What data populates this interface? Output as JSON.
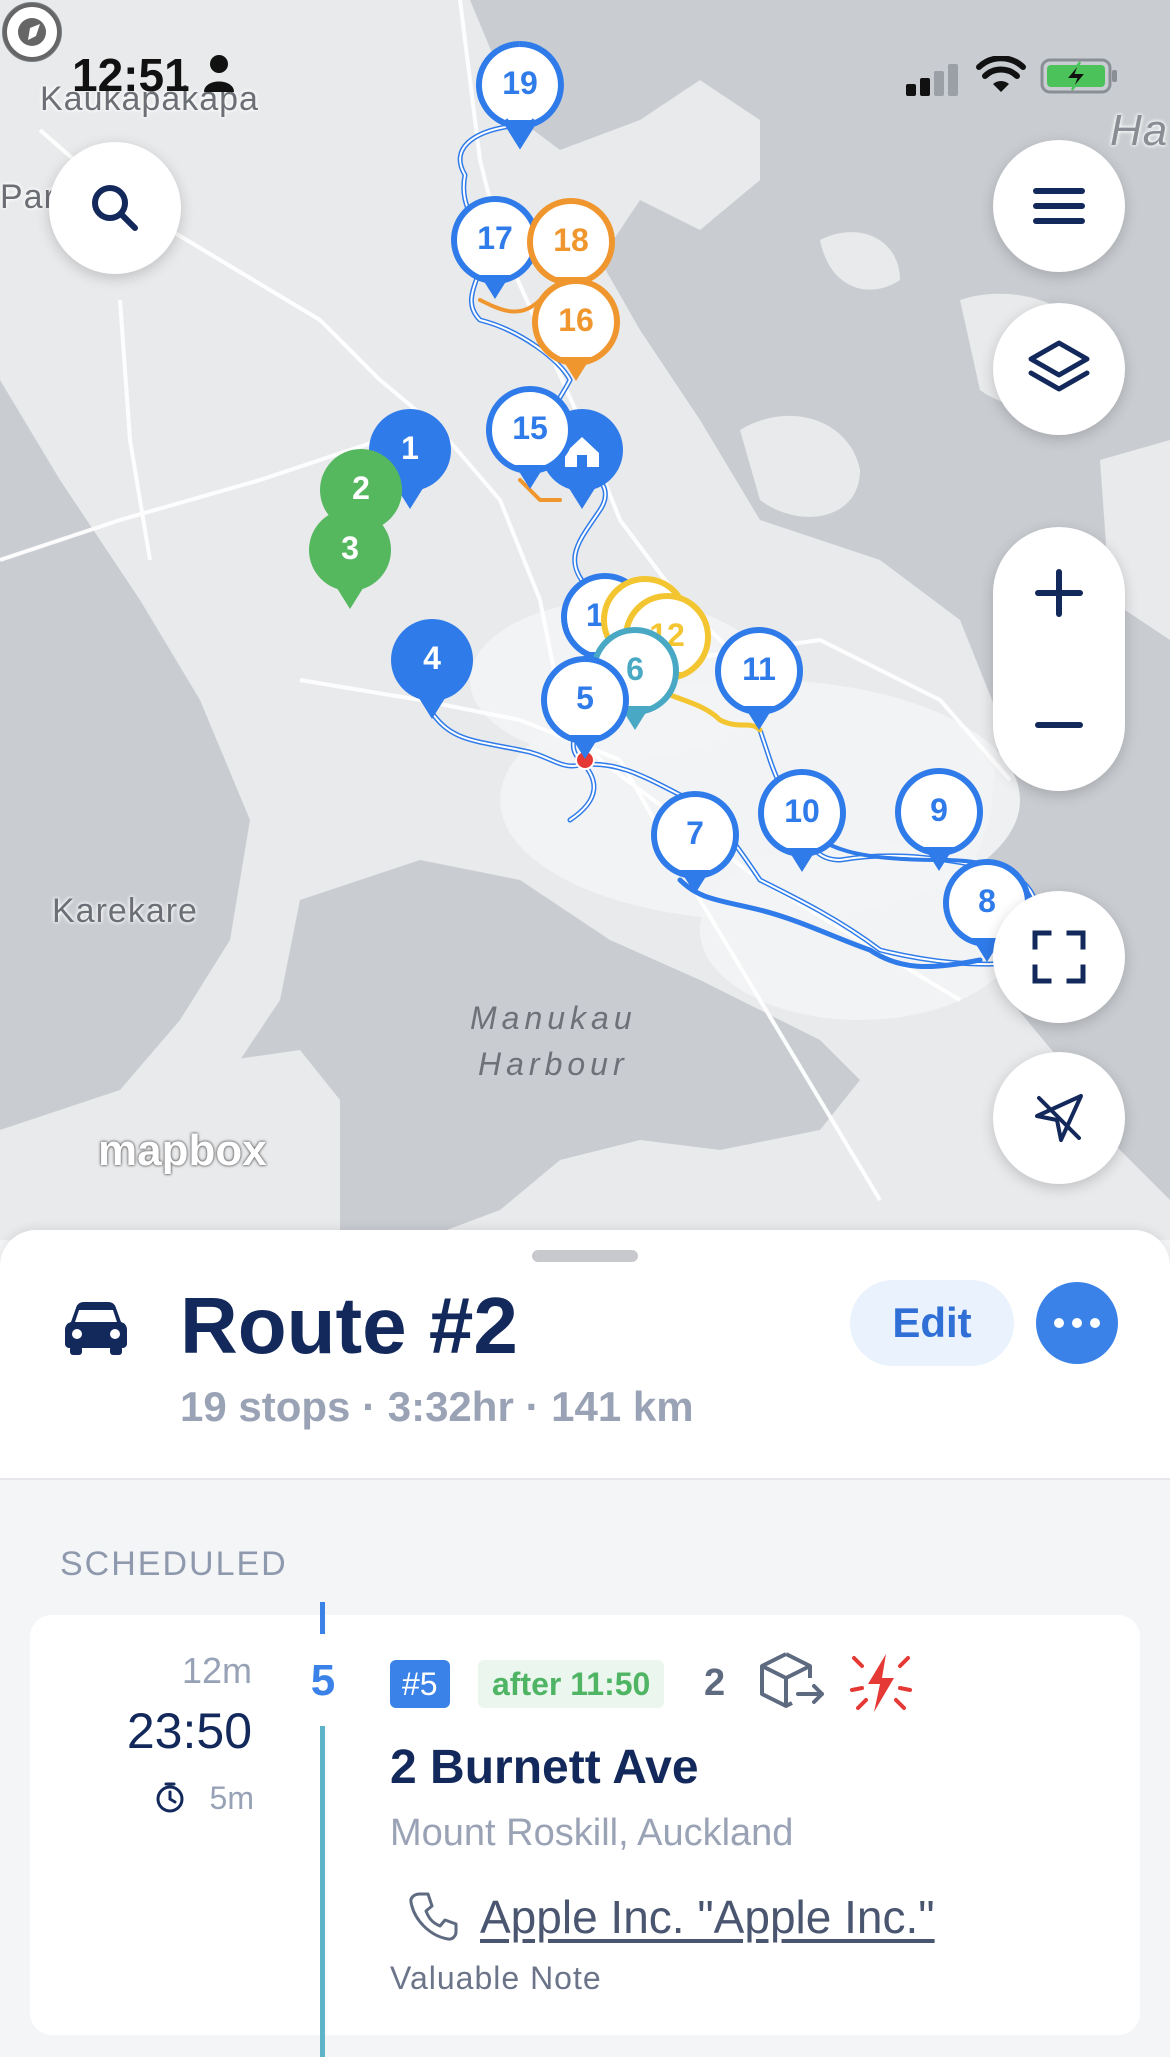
{
  "status_bar": {
    "time": "12:51"
  },
  "map": {
    "labels": {
      "kaukapakapa": "Kaukapakapa",
      "par": "Par",
      "ha": "Ha",
      "karekare": "Karekare",
      "harbour_line1": "Manukau",
      "harbour_line2": "Harbour"
    },
    "attribution": "mapbox",
    "markers": [
      {
        "label": "19",
        "color": "#2f7bea",
        "style": "outline"
      },
      {
        "label": "17",
        "color": "#2f7bea",
        "style": "outline"
      },
      {
        "label": "18",
        "color": "#f0962e",
        "style": "outline"
      },
      {
        "label": "16",
        "color": "#f0962e",
        "style": "outline"
      },
      {
        "label": "15",
        "color": "#2f7bea",
        "style": "outline"
      },
      {
        "label": "1",
        "color": "#2f7bea",
        "style": "filled"
      },
      {
        "label": "2",
        "color": "#55b85f",
        "style": "filled"
      },
      {
        "label": "3",
        "color": "#55b85f",
        "style": "filled"
      },
      {
        "label": "4",
        "color": "#2f7bea",
        "style": "filled"
      },
      {
        "label": "1",
        "color": "#2f7bea",
        "style": "outline"
      },
      {
        "label": "12",
        "color": "#f3c531",
        "style": "outline"
      },
      {
        "label": "6",
        "color": "#49a9c4",
        "style": "outline"
      },
      {
        "label": "5",
        "color": "#2f7bea",
        "style": "outline"
      },
      {
        "label": "11",
        "color": "#2f7bea",
        "style": "outline"
      },
      {
        "label": "10",
        "color": "#2f7bea",
        "style": "outline"
      },
      {
        "label": "9",
        "color": "#2f7bea",
        "style": "outline"
      },
      {
        "label": "7",
        "color": "#2f7bea",
        "style": "outline"
      },
      {
        "label": "8",
        "color": "#2f7bea",
        "style": "outline"
      }
    ]
  },
  "route": {
    "title": "Route #2",
    "summary": "19 stops · 3:32hr · 141 km",
    "edit_label": "Edit"
  },
  "section_label": "SCHEDULED",
  "stop": {
    "gap": "12m",
    "eta": "23:50",
    "duration": "5m",
    "number": "5",
    "id_badge": "#5",
    "time_window": "after 11:50",
    "item_count": "2",
    "address": "2 Burnett Ave",
    "city": "Mount Roskill, Auckland",
    "contact": "Apple Inc. \"Apple Inc.\"",
    "note": "Valuable Note"
  },
  "colors": {
    "primary": "#3b82e8",
    "navy": "#13295b",
    "orange": "#f0962e",
    "green": "#55b85f",
    "yellow": "#f3c531",
    "teal": "#49a9c4"
  }
}
